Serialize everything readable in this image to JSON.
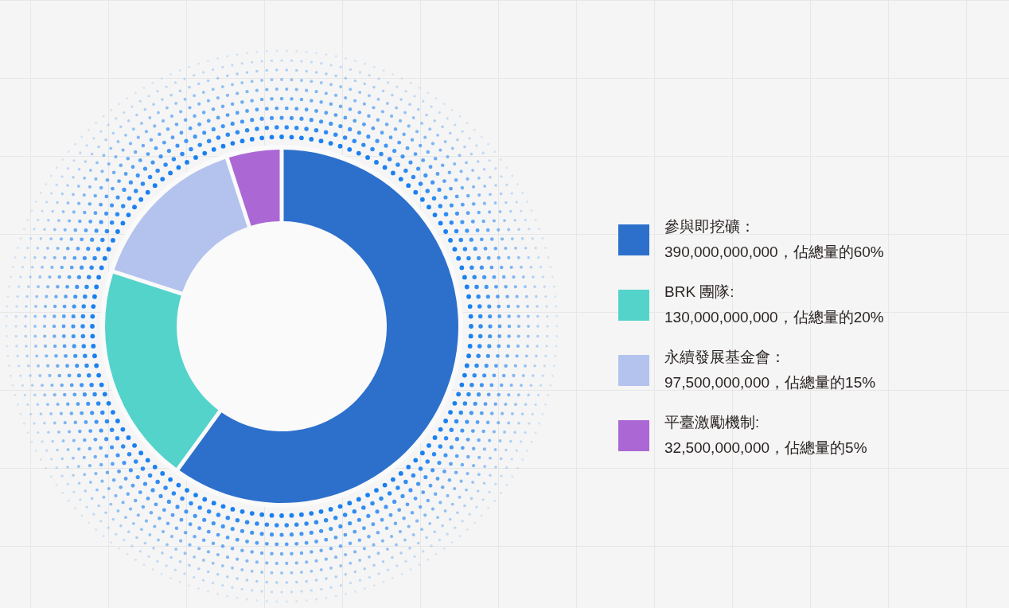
{
  "allocation": {
    "chart_data": {
      "type": "donut",
      "values": [
        60,
        20,
        15,
        5
      ]
    },
    "legend": [
      {
        "label": "參與即挖礦：",
        "amount": "390,000,000,000，佔總量的60%",
        "color": "#2d70cc"
      },
      {
        "label": "BRK 團隊:",
        "amount": "130,000,000,000，佔總量的20%",
        "color": "#54d3cb"
      },
      {
        "label": "永續發展基金會：",
        "amount": "97,500,000,000，佔總量的15%",
        "color": "#b4c3ee"
      },
      {
        "label": "平臺激勵機制:",
        "amount": "32,500,000,000，佔總量的5%",
        "color": "#ab68d5"
      }
    ]
  }
}
